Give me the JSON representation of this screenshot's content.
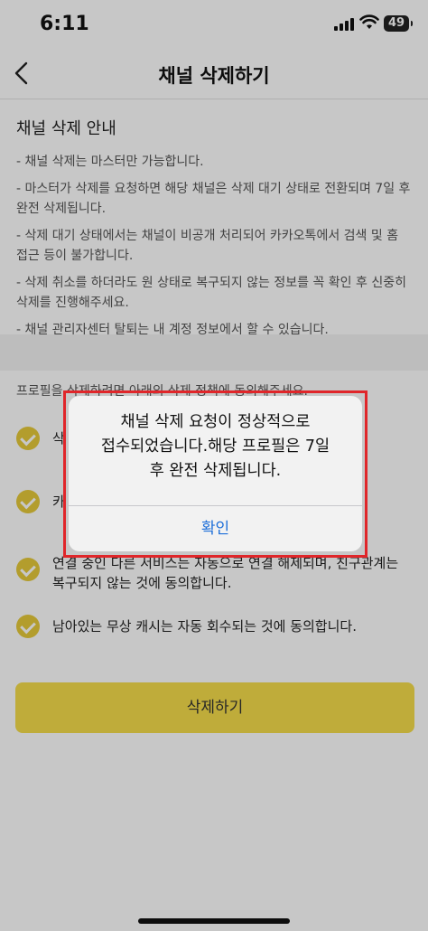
{
  "status_bar": {
    "time": "6:11",
    "battery": "49"
  },
  "nav": {
    "title": "채널 삭제하기"
  },
  "info": {
    "heading": "채널 삭제 안내",
    "lines": [
      "- 채널 삭제는 마스터만 가능합니다.",
      "- 마스터가 삭제를 요청하면 해당 채널은 삭제 대기 상태로 전환되며 7일 후 완전 삭제됩니다.",
      "- 삭제 대기 상태에서는 채널이 비공개 처리되어 카카오톡에서 검색 및 홈 접근 등이 불가합니다.",
      "- 삭제 취소를 하더라도 원 상태로 복구되지 않는 정보를 꼭 확인 후 신중히 삭제를 진행해주세요.",
      "- 채널 관리자센터 탈퇴는 내 계정 정보에서 할 수 있습니다."
    ]
  },
  "consent": {
    "label": "프로필을 삭제하려면 아래의 삭제 정책에 동의해주세요.",
    "items": [
      "삭",
      "카",
      "연결 중인 다른 서비스는 자동으로 연결 해제되며, 친구관계는 복구되지 않는 것에 동의합니다.",
      "남아있는 무상 캐시는 자동 회수되는 것에 동의합니다."
    ]
  },
  "delete_button": {
    "label": "삭제하기"
  },
  "dialog": {
    "message_line1": "채널 삭제 요청이 정상적으로",
    "message_line2": "접수되었습니다.해당 프로필은 7일",
    "message_line3": "후 완전 삭제됩니다.",
    "ok_label": "확인"
  },
  "colors": {
    "accent": "#f5dd4b",
    "check": "#e6c93a",
    "link": "#1e6fd9",
    "highlight": "#e0262a"
  }
}
